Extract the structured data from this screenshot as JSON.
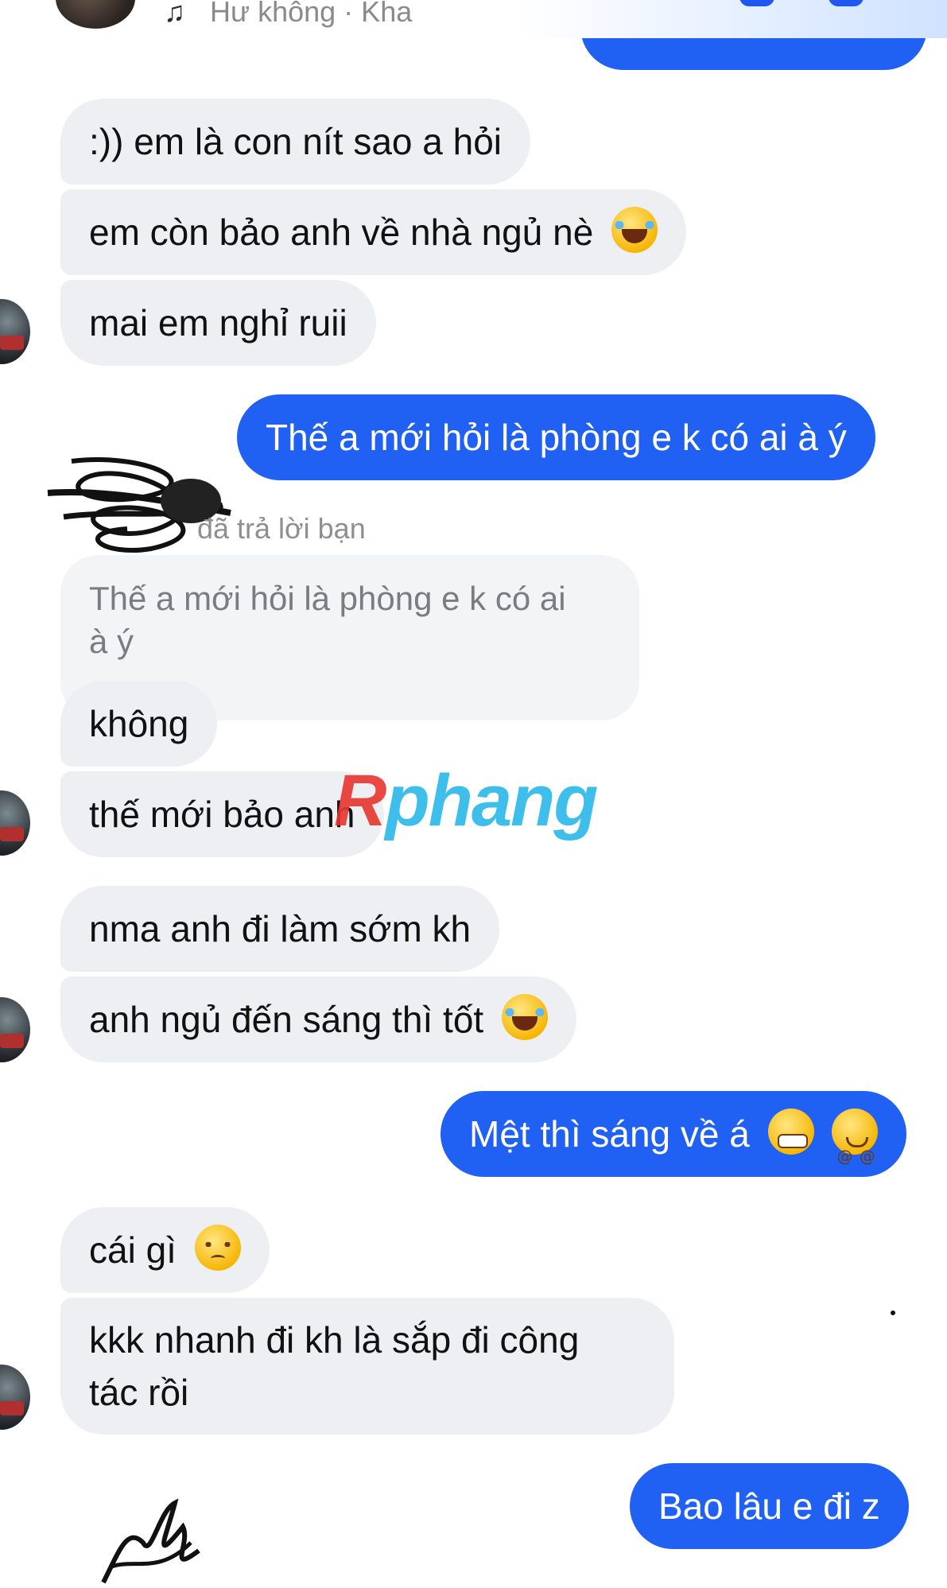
{
  "header": {
    "music_icon": "music-note-icon",
    "now_playing": "Hư không · Kha"
  },
  "messages": [
    {
      "side": "in",
      "text": ":)) em là con nít sao a hỏi",
      "emoji": []
    },
    {
      "side": "in",
      "text": "em còn bảo anh về nhà ngủ nè",
      "emoji": [
        "laugh-crying-emoji"
      ]
    },
    {
      "side": "in",
      "text": "mai em nghỉ ruii",
      "emoji": []
    },
    {
      "side": "out",
      "text": "Thế a mới hỏi là phòng e k có ai à ý",
      "emoji": []
    },
    {
      "side": "in",
      "text": "không",
      "emoji": []
    },
    {
      "side": "in",
      "text": "thế mới bảo anh",
      "emoji": []
    },
    {
      "side": "in",
      "text": "nma anh đi làm sớm kh",
      "emoji": []
    },
    {
      "side": "in",
      "text": "anh ngủ đến sáng thì tốt",
      "emoji": [
        "laugh-crying-emoji"
      ]
    },
    {
      "side": "out",
      "text": "Mệt thì sáng về á",
      "emoji": [
        "grimace-emoji",
        "dizzy-face-emoji"
      ]
    },
    {
      "side": "in",
      "text": "cái gì",
      "emoji": [
        "pensive-emoji"
      ]
    },
    {
      "side": "in",
      "text": "kkk nhanh đi kh là sắp đi công",
      "text2": "tác rồi",
      "emoji": []
    },
    {
      "side": "out",
      "text": "Bao lâu e đi z",
      "emoji": []
    }
  ],
  "reply": {
    "label": "đã trả lời bạn",
    "quoted_line1": "Thế a mới hỏi là phòng e k có ai",
    "quoted_line2": "à ý"
  },
  "watermark": {
    "first": "R",
    "rest": "phang"
  },
  "colors": {
    "outgoing": "#2060f2",
    "incoming": "#eeeff2",
    "watermark_red": "#e8352e",
    "watermark_blue": "#2ab7e8"
  }
}
